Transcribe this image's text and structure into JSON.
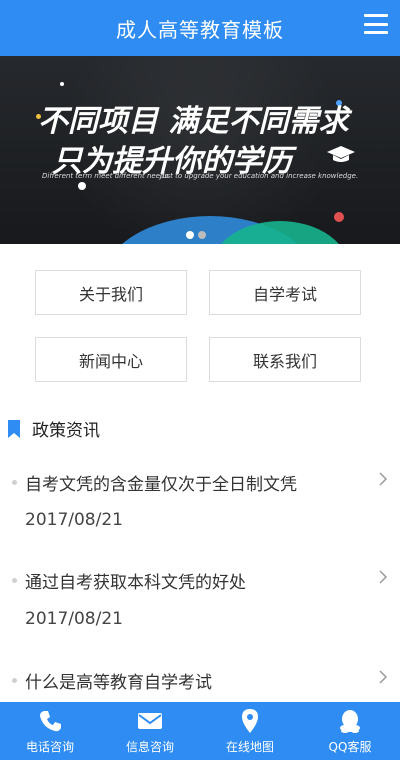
{
  "header": {
    "title": "成人高等教育模板",
    "menu_icon": "hamburger-menu-icon"
  },
  "banner": {
    "headline_line1": "不同项目 满足不同需求",
    "headline_line2": "只为提升你的学历",
    "sub_left": "Different term meet different needs.",
    "sub_right": "Just to upgrade your education and increase knowledge.",
    "slides_total": 2,
    "active_slide": 1
  },
  "nav": {
    "items": [
      {
        "label": "关于我们"
      },
      {
        "label": "自学考试"
      },
      {
        "label": "新闻中心"
      },
      {
        "label": "联系我们"
      }
    ]
  },
  "policy": {
    "title": "政策资讯",
    "accent_color": "#2f8cf2",
    "items": [
      {
        "headline": "自考文凭的含金量仅次于全日制文凭",
        "date": "2017/08/21"
      },
      {
        "headline": "通过自考获取本科文凭的好处",
        "date": "2017/08/21"
      },
      {
        "headline": "什么是高等教育自学考试",
        "date": ""
      }
    ]
  },
  "footer": {
    "tabs": [
      {
        "label": "电话咨询",
        "icon": "phone-icon"
      },
      {
        "label": "信息咨询",
        "icon": "mail-icon"
      },
      {
        "label": "在线地图",
        "icon": "map-pin-icon"
      },
      {
        "label": "QQ客服",
        "icon": "qq-penguin-icon"
      }
    ]
  },
  "colors": {
    "primary": "#2f8cf2",
    "banner_bg": "#1c1f23"
  }
}
